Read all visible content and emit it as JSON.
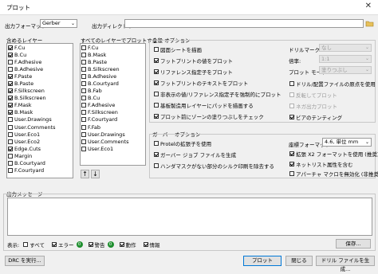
{
  "window": {
    "title": "プロット"
  },
  "top": {
    "format_label": "出力フォーマット:",
    "format_value": "Gerber",
    "dir_label": "出力ディレクトリ:",
    "dir_value": ""
  },
  "layers": {
    "included_label": "含めるレイヤー",
    "included": [
      {
        "name": "F.Cu",
        "checked": true
      },
      {
        "name": "B.Cu",
        "checked": true
      },
      {
        "name": "F.Adhesive",
        "checked": false
      },
      {
        "name": "B.Adhesive",
        "checked": false
      },
      {
        "name": "F.Paste",
        "checked": true
      },
      {
        "name": "B.Paste",
        "checked": true
      },
      {
        "name": "F.Silkscreen",
        "checked": true
      },
      {
        "name": "B.Silkscreen",
        "checked": true
      },
      {
        "name": "F.Mask",
        "checked": true
      },
      {
        "name": "B.Mask",
        "checked": true
      },
      {
        "name": "User.Drawings",
        "checked": false
      },
      {
        "name": "User.Comments",
        "checked": false
      },
      {
        "name": "User.Eco1",
        "checked": false
      },
      {
        "name": "User.Eco2",
        "checked": false
      },
      {
        "name": "Edge.Cuts",
        "checked": true
      },
      {
        "name": "Margin",
        "checked": false
      },
      {
        "name": "B.Courtyard",
        "checked": false
      },
      {
        "name": "F.Courtyard",
        "checked": false
      }
    ],
    "all_label": "すべてのレイヤーでプロットする",
    "all": [
      {
        "name": "F.Cu",
        "checked": false
      },
      {
        "name": "B.Mask",
        "checked": false
      },
      {
        "name": "B.Paste",
        "checked": false
      },
      {
        "name": "B.Silkscreen",
        "checked": false
      },
      {
        "name": "B.Adhesive",
        "checked": false
      },
      {
        "name": "B.Courtyard",
        "checked": false
      },
      {
        "name": "B.Fab",
        "checked": false
      },
      {
        "name": "B.Cu",
        "checked": false
      },
      {
        "name": "F.Adhesive",
        "checked": false
      },
      {
        "name": "F.Silkscreen",
        "checked": false
      },
      {
        "name": "F.Courtyard",
        "checked": false
      },
      {
        "name": "F.Fab",
        "checked": false
      },
      {
        "name": "User.Drawings",
        "checked": false
      },
      {
        "name": "User.Comments",
        "checked": false
      },
      {
        "name": "User.Eco1",
        "checked": false
      }
    ],
    "up_arrow": "↑",
    "down_arrow": "↓"
  },
  "general": {
    "label": "全般 オプション",
    "options": [
      {
        "label": "図面シートを描画",
        "checked": false
      },
      {
        "label": "フットプリントの値をプロット",
        "checked": true
      },
      {
        "label": "リファレンス指定子をプロット",
        "checked": true
      },
      {
        "label": "フットプリントのテキストをプロット",
        "checked": true
      },
      {
        "label": "非表示の値/リファレンス指定子を強制的にプロット",
        "checked": false
      },
      {
        "label": "基板製造用レイヤーにパッドを描画する",
        "checked": false
      },
      {
        "label": "プロット前にゾーンの塗りつぶしをチェック",
        "checked": true
      }
    ],
    "drill_mark_label": "ドリルマーク:",
    "drill_mark_value": "なし",
    "scale_label": "倍率:",
    "scale_value": "1:1",
    "plot_mode_label": "プロット モード:",
    "plot_mode_value": "塗りつぶし",
    "right_options": [
      {
        "label": "ドリル/配置ファイルの原点を使用",
        "checked": false,
        "disabled": false
      },
      {
        "label": "反転してプロット",
        "checked": false,
        "disabled": true
      },
      {
        "label": "ネガ出力プロット",
        "checked": false,
        "disabled": true
      },
      {
        "label": "ビアのテンティング",
        "checked": true,
        "disabled": false
      }
    ]
  },
  "gerber": {
    "label": "ガーバー オプション",
    "options": [
      {
        "label": "Protelの拡張子を使用",
        "checked": false
      },
      {
        "label": "ガーバー ジョブ ファイルを生成",
        "checked": true
      },
      {
        "label": "ハンダマスクがない部分のシルク印刷を除去する",
        "checked": false
      }
    ],
    "coord_label": "座標フォーマット:",
    "coord_value": "4.6, 単位 mm",
    "right_options": [
      {
        "label": "拡張 X2 フォーマットを使用 (推奨)",
        "checked": true
      },
      {
        "label": "ネットリスト属性を含む",
        "checked": true
      },
      {
        "label": "アパーチャ マクロを無効化 (非推奨)",
        "checked": false
      }
    ]
  },
  "messages": {
    "label": "出力メッセージ"
  },
  "filter": {
    "show_label": "表示:",
    "all_label": "すべて",
    "error_label": "エラー",
    "error_count": "0",
    "warning_label": "警告",
    "warning_count": "0",
    "action_label": "動作",
    "info_label": "情報",
    "save_label": "保存..."
  },
  "bottom": {
    "drc_label": "DRC を実行...",
    "plot_label": "プロット",
    "close_label": "閉じる",
    "drill_label": "ドリル ファイルを生成..."
  },
  "colors": {
    "accent": "#0078d7",
    "badge": "#1f8f2f"
  }
}
